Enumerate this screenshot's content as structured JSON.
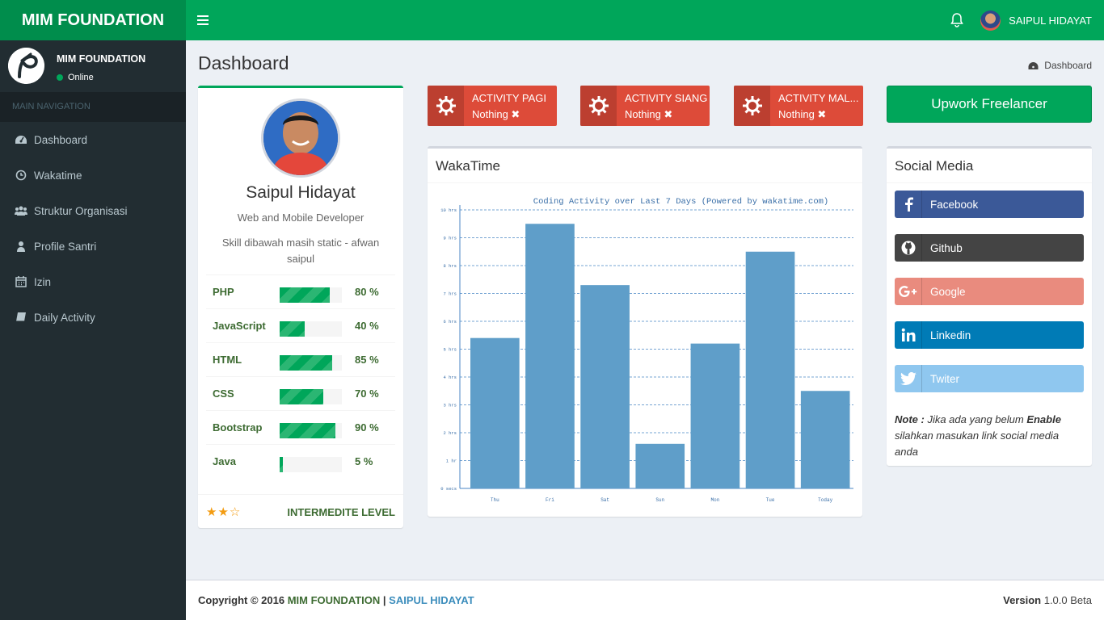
{
  "brand": "MIM FOUNDATION",
  "header": {
    "user_name": "SAIPUL HIDAYAT"
  },
  "sidebar": {
    "org_name": "MIM FOUNDATION",
    "status": "Online",
    "nav_header": "MAIN NAVIGATION",
    "items": [
      {
        "label": "Dashboard",
        "icon": "dashboard-icon"
      },
      {
        "label": "Wakatime",
        "icon": "clock-icon"
      },
      {
        "label": "Struktur Organisasi",
        "icon": "users-icon"
      },
      {
        "label": "Profile Santri",
        "icon": "user-icon"
      },
      {
        "label": "Izin",
        "icon": "calendar-icon"
      },
      {
        "label": "Daily Activity",
        "icon": "book-icon"
      }
    ]
  },
  "page": {
    "title": "Dashboard",
    "breadcrumb": "Dashboard"
  },
  "profile": {
    "name": "Saipul Hidayat",
    "role": "Web and Mobile Developer",
    "note": "Skill dibawah masih static - afwan saipul",
    "skills": [
      {
        "name": "PHP",
        "percent": 80,
        "label": "80 %"
      },
      {
        "name": "JavaScript",
        "percent": 40,
        "label": "40 %"
      },
      {
        "name": "HTML",
        "percent": 85,
        "label": "85 %"
      },
      {
        "name": "CSS",
        "percent": 70,
        "label": "70 %"
      },
      {
        "name": "Bootstrap",
        "percent": 90,
        "label": "90 %"
      },
      {
        "name": "Java",
        "percent": 5,
        "label": "5 %"
      }
    ],
    "stars": {
      "filled": 2,
      "total": 3,
      "text": "★★☆"
    },
    "level": "INTERMEDITE LEVEL"
  },
  "activities": [
    {
      "title": "ACTIVITY PAGI",
      "value": "Nothing ✖"
    },
    {
      "title": "ACTIVITY SIANG",
      "value": "Nothing ✖"
    },
    {
      "title": "ACTIVITY MAL...",
      "value": "Nothing ✖"
    }
  ],
  "upwork": {
    "label": "Upwork Freelancer"
  },
  "waka": {
    "title": "WakaTime"
  },
  "chart_data": {
    "type": "bar",
    "title": "Coding Activity over Last 7 Days (Powered by wakatime.com)",
    "categories": [
      "Thu",
      "Fri",
      "Sat",
      "Sun",
      "Mon",
      "Tue",
      "Today"
    ],
    "values": [
      5.4,
      9.5,
      7.3,
      1.6,
      5.2,
      8.5,
      3.5
    ],
    "y_ticks": [
      "0 secs",
      "1 hr",
      "2 hrs",
      "3 hrs",
      "4 hrs",
      "5 hrs",
      "6 hrs",
      "7 hrs",
      "8 hrs",
      "9 hrs",
      "10 hrs"
    ],
    "ylim": [
      0,
      10
    ],
    "grid": true,
    "color": "#5f9ec9"
  },
  "social": {
    "title": "Social Media",
    "buttons": [
      {
        "label": "Facebook",
        "icon": "facebook-icon",
        "color": "#3b5998"
      },
      {
        "label": "Github",
        "icon": "github-icon",
        "color": "#444444"
      },
      {
        "label": "Google",
        "icon": "google-plus-icon",
        "color": "#e98b7e"
      },
      {
        "label": "Linkedin",
        "icon": "linkedin-icon",
        "color": "#007bb6"
      },
      {
        "label": "Twiter",
        "icon": "twitter-icon",
        "color": "#8fc7ef"
      }
    ],
    "note_prefix": "Note :",
    "note_mid": " Jika ada yang belum ",
    "note_bold": "Enable",
    "note_suffix": " silahkan masukan link social media anda"
  },
  "footer": {
    "copyright": "Copyright © 2016 ",
    "org": "MIM FOUNDATION",
    "sep": " | ",
    "author": "SAIPUL HIDAYAT",
    "version_label": "Version",
    "version": "1.0.0 Beta"
  }
}
